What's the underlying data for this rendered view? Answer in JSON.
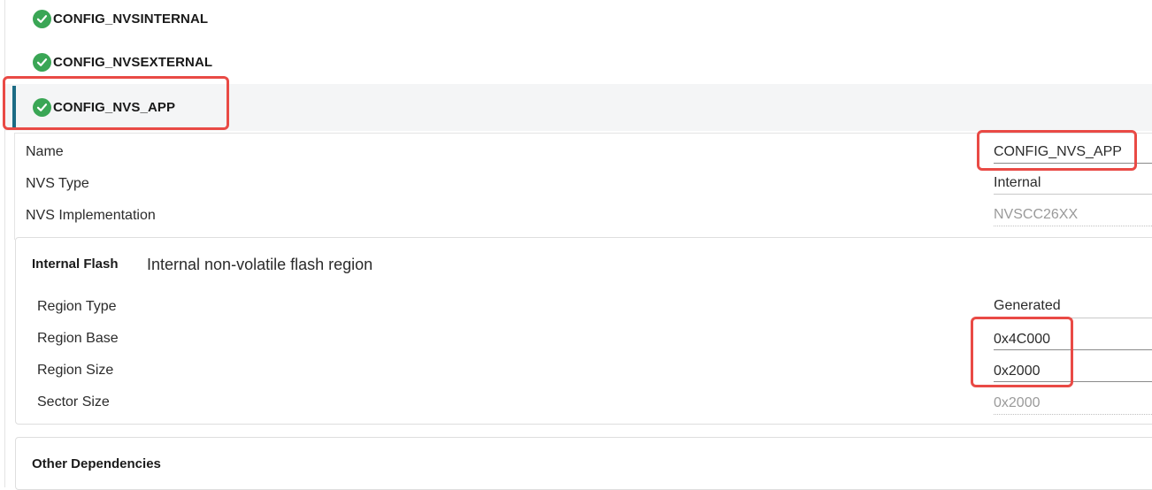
{
  "instances": [
    {
      "label": "CONFIG_NVSINTERNAL",
      "status": "valid",
      "selected": false
    },
    {
      "label": "CONFIG_NVSEXTERNAL",
      "status": "valid",
      "selected": false
    },
    {
      "label": "CONFIG_NVS_APP",
      "status": "valid",
      "selected": true
    }
  ],
  "properties": {
    "name": {
      "label": "Name",
      "value": "CONFIG_NVS_APP"
    },
    "nvs_type": {
      "label": "NVS Type",
      "value": "Internal"
    },
    "nvs_implementation": {
      "label": "NVS Implementation",
      "value": "NVSCC26XX"
    }
  },
  "internal_flash": {
    "title": "Internal Flash",
    "description": "Internal non-volatile flash region",
    "region_type": {
      "label": "Region Type",
      "value": "Generated"
    },
    "region_base": {
      "label": "Region Base",
      "value": "0x4C000"
    },
    "region_size": {
      "label": "Region Size",
      "value": "0x2000"
    },
    "sector_size": {
      "label": "Sector Size",
      "value": "0x2000"
    }
  },
  "other_dependencies": {
    "title": "Other Dependencies"
  },
  "colors": {
    "check_green": "#3aa655",
    "selection_accent": "#1b6b84",
    "highlight_red": "#e94a45"
  },
  "icons": {
    "instance_status": "check-circle-icon"
  }
}
